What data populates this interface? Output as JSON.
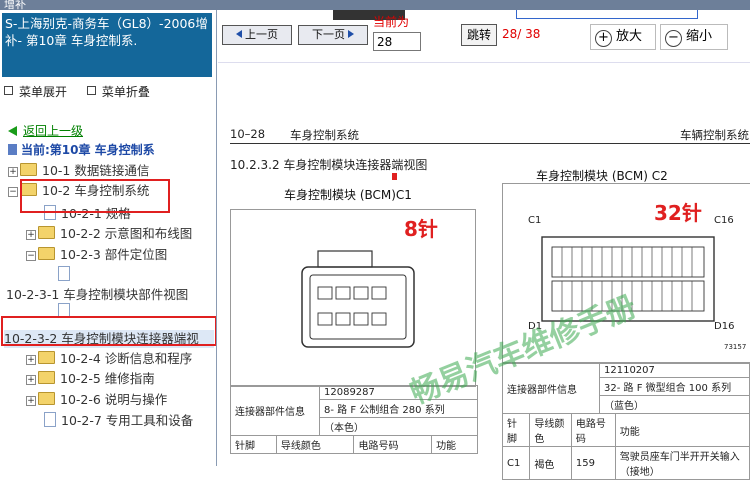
{
  "window": {
    "topstrip_text": "增补"
  },
  "sidebar": {
    "title": "S-上海别克-商务车（GL8）-2006增补- 第10章 车身控制系.",
    "expand_label": "菜单展开",
    "collapse_label": "菜单折叠",
    "back_label": "返回上一级",
    "current_label": "当前:第10章 车身控制系",
    "tree": [
      {
        "label": "10-1 数据链接通信"
      },
      {
        "label": "10-2 车身控制系统"
      },
      {
        "label": "10-2-1 规格"
      },
      {
        "label": "10-2-2 示意图和布线图"
      },
      {
        "label": "10-2-3 部件定位图"
      },
      {
        "label": ""
      },
      {
        "label": "10-2-3-1 车身控制模块部件视图"
      },
      {
        "label": "10-2-3-2 车身控制模块连接器端视"
      },
      {
        "label": "10-2-4 诊断信息和程序"
      },
      {
        "label": "10-2-5 维修指南"
      },
      {
        "label": "10-2-6 说明与操作"
      },
      {
        "label": "10-2-7 专用工具和设备"
      }
    ]
  },
  "toolbar": {
    "prev_label": "上一页",
    "next_label": "下一页",
    "current_page_label": "当前为",
    "current_page_value": "28",
    "go_label": "跳转",
    "page_count": "28/ 38",
    "zoom_in_label": "放大",
    "zoom_out_label": "缩小"
  },
  "document": {
    "header_left": "10–28",
    "header_center": "车身控制系统",
    "header_right": "车辆控制系统",
    "section_title": "10.2.3.2 车身控制模块连接器端视图",
    "c1_title": "车身控制模块 (BCM)C1",
    "c1_pins_note": "8针",
    "c2_title": "车身控制模块 (BCM) C2",
    "c2_pins_note": "32针",
    "c2_pin_c1": "C1",
    "c2_pin_c16": "C16",
    "c2_pin_d1": "D1",
    "c2_pin_d16": "D16",
    "c2_figure_no": "73157",
    "c1_spec_label": "连接器部件信息",
    "c1_spec_1": "12089287",
    "c1_spec_2": "8- 路 F 公制组合 280 系列",
    "c1_spec_3": "（本色）",
    "c2_spec_label": "连接器部件信息",
    "c2_spec_1": "12110207",
    "c2_spec_2": "32- 路 F 微型组合 100 系列",
    "c2_spec_3": "（蓝色）",
    "table_headers": [
      "针脚",
      "导线颜色",
      "电路号码",
      "功能"
    ],
    "c2_row": {
      "pin": "C1",
      "color": "褐色",
      "circuit": "159",
      "function": "驾驶员座车门半开开关输入（接地）"
    },
    "watermark": "畅易汽车维修手册"
  }
}
